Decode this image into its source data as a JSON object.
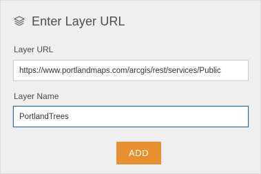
{
  "header": {
    "icon": "layers-icon",
    "title": "Enter Layer URL"
  },
  "form": {
    "url_label": "Layer URL",
    "url_value": "https://www.portlandmaps.com/arcgis/rest/services/Public",
    "name_label": "Layer Name",
    "name_value": "PortlandTrees",
    "add_label": "ADD"
  },
  "colors": {
    "accent_button": "#e8902f",
    "focus_border": "#2b6aa8",
    "panel_background": "#efefef"
  }
}
